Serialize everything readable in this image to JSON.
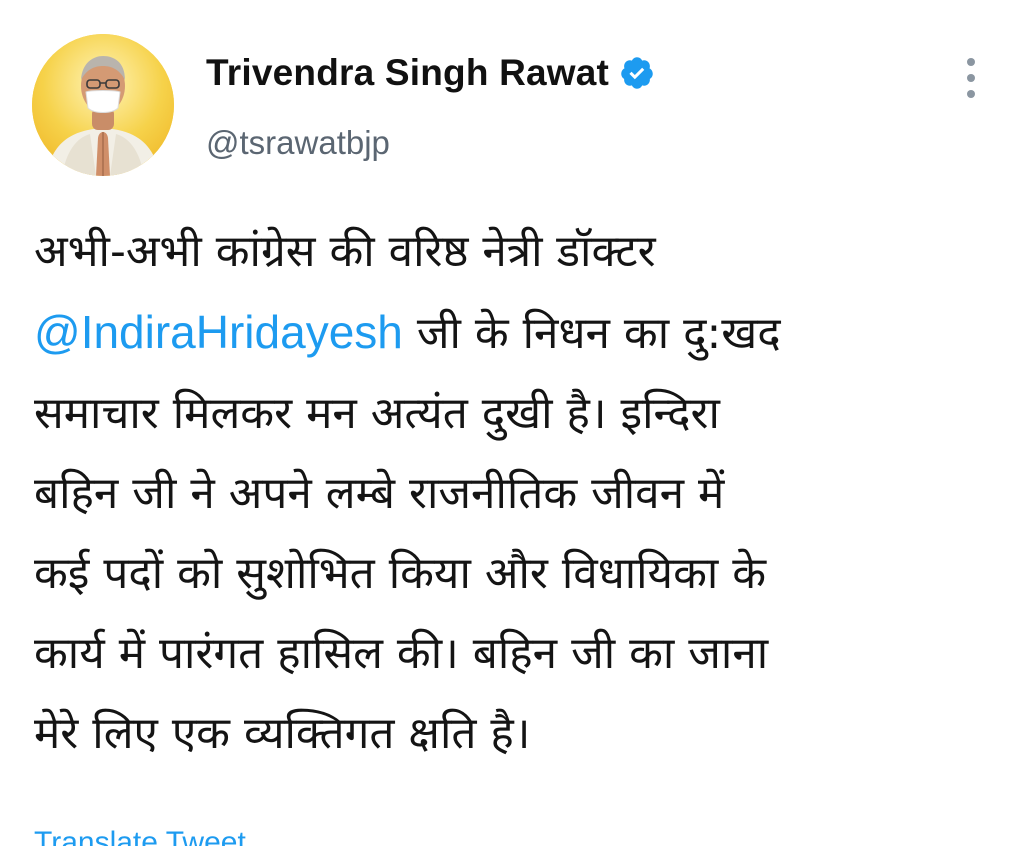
{
  "author": {
    "display_name": "Trivendra Singh Rawat",
    "handle": "@tsrawatbjp",
    "verified": true,
    "verified_badge_icon": "verified-badge-icon",
    "avatar_icon": "profile-photo"
  },
  "tweet": {
    "lines": [
      {
        "pre": "अभी-अभी कांग्रेस की वरिष्ठ नेत्री डॉक्टर",
        "mention": "",
        "post": ""
      },
      {
        "pre": "",
        "mention": "@IndiraHridayesh",
        "post": " जी के निधन का दु:खद"
      },
      {
        "pre": "समाचार मिलकर मन अत्यंत दुखी है। इन्दिरा",
        "mention": "",
        "post": ""
      },
      {
        "pre": "बहिन जी ने अपने लम्बे राजनीतिक जीवन में",
        "mention": "",
        "post": ""
      },
      {
        "pre": "कई पदों को सुशोभित किया और विधायिका के",
        "mention": "",
        "post": ""
      },
      {
        "pre": "कार्य में पारंगत हासिल की। बहिन जी का जाना",
        "mention": "",
        "post": ""
      },
      {
        "pre": "मेरे लिए एक व्यक्तिगत क्षति है।",
        "mention": "",
        "post": ""
      }
    ],
    "translate_label": "Translate Tweet"
  },
  "colors": {
    "link": "#1d9bf0",
    "handle": "#5b6672",
    "text": "#141414",
    "avatar_bg": "#f4cf45"
  },
  "menu": {
    "more_icon": "more-vertical-icon"
  }
}
